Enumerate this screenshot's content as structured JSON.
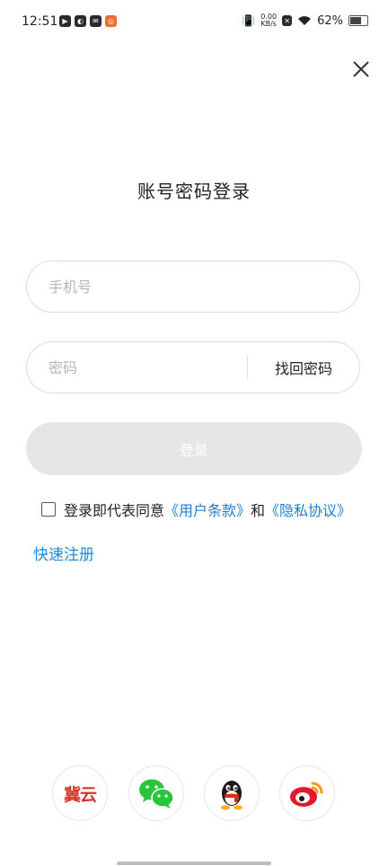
{
  "status_bar": {
    "time": "12:51",
    "net_speed_value": "0.00",
    "net_speed_unit": "KB/s",
    "battery_percent": "62%"
  },
  "title": "账号密码登录",
  "phone_field": {
    "placeholder": "手机号"
  },
  "password_field": {
    "placeholder": "密码",
    "forgot_label": "找回密码"
  },
  "login_button": {
    "label": "登录"
  },
  "agreement": {
    "prefix": "登录即代表同意",
    "terms_link": "《用户条款》",
    "conjunction": "和",
    "privacy_link": "《隐私协议》"
  },
  "register_link": "快速注册",
  "social_logins": {
    "jiyun_label": "冀云"
  },
  "colors": {
    "link": "#1a7fd6",
    "login_button_bg": "#e6e6e6",
    "wechat": "#2bc43c",
    "weibo": "#e6162d"
  }
}
